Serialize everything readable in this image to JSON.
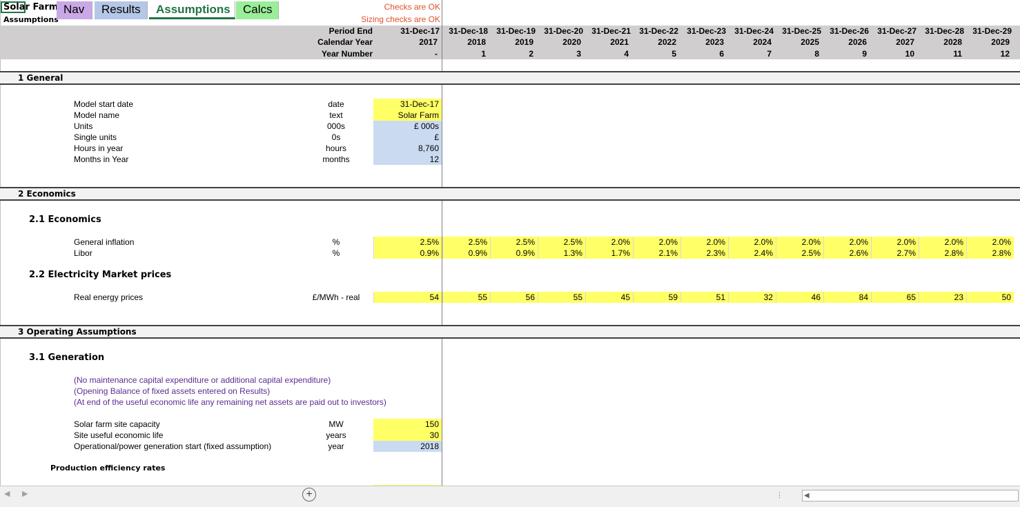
{
  "title": {
    "line1": "Solar Farm",
    "line2": "Assumptions"
  },
  "checks": {
    "checks": "Checks are OK",
    "sizing": "Sizing checks are OK"
  },
  "header": {
    "period_end_label": "Period End",
    "calendar_year_label": "Calendar Year",
    "year_number_label": "Year Number",
    "columns": [
      {
        "date": "31-Dec-17",
        "year": "2017",
        "num": "-"
      },
      {
        "date": "31-Dec-18",
        "year": "2018",
        "num": "1"
      },
      {
        "date": "31-Dec-19",
        "year": "2019",
        "num": "2"
      },
      {
        "date": "31-Dec-20",
        "year": "2020",
        "num": "3"
      },
      {
        "date": "31-Dec-21",
        "year": "2021",
        "num": "4"
      },
      {
        "date": "31-Dec-22",
        "year": "2022",
        "num": "5"
      },
      {
        "date": "31-Dec-23",
        "year": "2023",
        "num": "6"
      },
      {
        "date": "31-Dec-24",
        "year": "2024",
        "num": "7"
      },
      {
        "date": "31-Dec-25",
        "year": "2025",
        "num": "8"
      },
      {
        "date": "31-Dec-26",
        "year": "2026",
        "num": "9"
      },
      {
        "date": "31-Dec-27",
        "year": "2027",
        "num": "10"
      },
      {
        "date": "31-Dec-28",
        "year": "2028",
        "num": "11"
      },
      {
        "date": "31-Dec-29",
        "year": "2029",
        "num": "12"
      }
    ]
  },
  "sections": {
    "general": "1 General",
    "economics": "2 Economics",
    "econ_sub": "2.1  Economics",
    "market_sub": "2.2  Electricity Market prices",
    "operating": "3 Operating Assumptions",
    "generation_sub": "3.1  Generation",
    "production_label": "Production efficiency rates"
  },
  "general": [
    {
      "label": "Model start date",
      "unit": "date",
      "value": "31-Dec-17",
      "color": "yellow"
    },
    {
      "label": "Model name",
      "unit": "text",
      "value": "Solar Farm",
      "color": "yellow"
    },
    {
      "label": "Units",
      "unit": "000s",
      "value": "£ 000s",
      "color": "blue"
    },
    {
      "label": "Single units",
      "unit": "0s",
      "value": "£",
      "color": "blue"
    },
    {
      "label": "Hours in year",
      "unit": "hours",
      "value": "8,760",
      "color": "blue"
    },
    {
      "label": "Months in Year",
      "unit": "months",
      "value": "12",
      "color": "blue"
    }
  ],
  "economics": [
    {
      "label": "General inflation",
      "unit": "%",
      "values": [
        "2.5%",
        "2.5%",
        "2.5%",
        "2.5%",
        "2.0%",
        "2.0%",
        "2.0%",
        "2.0%",
        "2.0%",
        "2.0%",
        "2.0%",
        "2.0%",
        "2.0%"
      ]
    },
    {
      "label": "Libor",
      "unit": "%",
      "values": [
        "0.9%",
        "0.9%",
        "0.9%",
        "1.3%",
        "1.7%",
        "2.1%",
        "2.3%",
        "2.4%",
        "2.5%",
        "2.6%",
        "2.7%",
        "2.8%",
        "2.8%"
      ]
    }
  ],
  "market": {
    "label": "Real energy prices",
    "unit": "£/MWh - real",
    "values": [
      "54",
      "55",
      "56",
      "55",
      "45",
      "59",
      "51",
      "32",
      "46",
      "84",
      "65",
      "23",
      "50"
    ]
  },
  "notes": [
    "(No maintenance capital expenditure or additional capital expenditure)",
    "(Opening Balance of fixed assets entered on Results)",
    "(At end of the useful economic life any remaining net assets are paid out to investors)"
  ],
  "generation": [
    {
      "label": "Solar farm site capacity",
      "unit": "MW",
      "value": "150",
      "color": "yellow"
    },
    {
      "label": "Site useful economic life",
      "unit": "years",
      "value": "30",
      "color": "yellow"
    },
    {
      "label": "Operational/power generation start (fixed assumption)",
      "unit": "year",
      "value": "2018",
      "color": "blue"
    }
  ],
  "tabs": [
    {
      "label": "Nav",
      "color": "#c9a8e6"
    },
    {
      "label": "Results",
      "color": "#b4c7e7"
    },
    {
      "label": "Assumptions",
      "color": "#ffffff"
    },
    {
      "label": "Calcs",
      "color": "#99ee99"
    }
  ],
  "colors": {
    "yellow": "#ffff66",
    "blue": "#c9daf1",
    "header_band": "#d0cece",
    "active_tab": "#217346",
    "check_text": "#e0502a",
    "note_text": "#5b2c91"
  }
}
